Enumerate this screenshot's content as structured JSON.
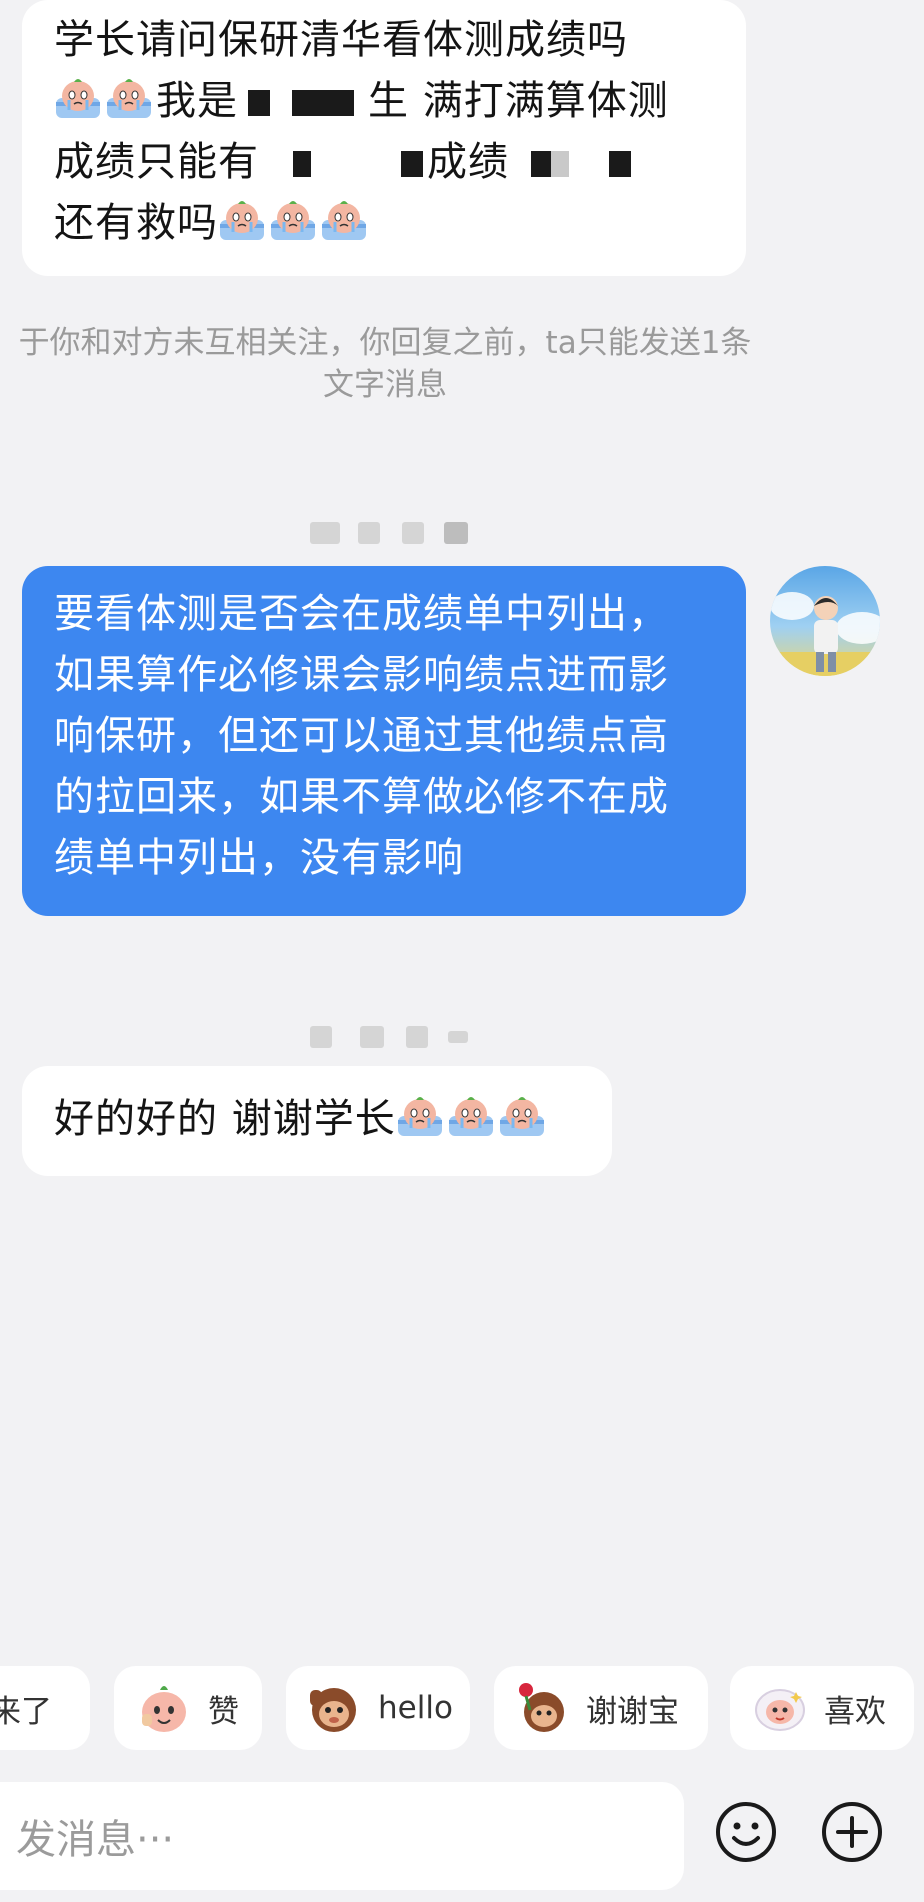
{
  "messages": [
    {
      "side": "in",
      "lines": [
        "学长请问保研清华看体测成绩吗",
        "我是",
        "生 满打满算体测",
        "成绩只能有",
        "成绩",
        "还有救吗"
      ]
    },
    {
      "side": "out",
      "lines": [
        "要看体测是否会在成绩单中列出，",
        "如果算作必修课会影响绩点进而影",
        "响保研，但还可以通过其他绩点高",
        "的拉回来，如果不算做必修不在成",
        "绩单中列出，没有影响"
      ]
    },
    {
      "side": "in",
      "lines": [
        "好的好的 谢谢学长"
      ]
    }
  ],
  "notice": {
    "line1": "于你和对方未互相关注，你回复之前，ta只能发送1条",
    "line2": "文字消息"
  },
  "quick_replies": [
    {
      "label": "来了",
      "icon": "sticker-icon"
    },
    {
      "label": "赞",
      "icon": "thumbs-sticker-icon"
    },
    {
      "label": "hello",
      "icon": "monkey-sticker-icon"
    },
    {
      "label": "谢谢宝",
      "icon": "rose-monkey-sticker-icon"
    },
    {
      "label": "喜欢",
      "icon": "cloud-sticker-icon"
    }
  ],
  "composer": {
    "placeholder": "发消息···",
    "emoji_icon": "smiley-icon",
    "plus_icon": "plus-circle-icon"
  },
  "colors": {
    "background": "#f2f2f4",
    "outgoing_bubble": "#3d87f0",
    "incoming_bubble": "#ffffff",
    "notice_text": "#9a9a9a"
  }
}
